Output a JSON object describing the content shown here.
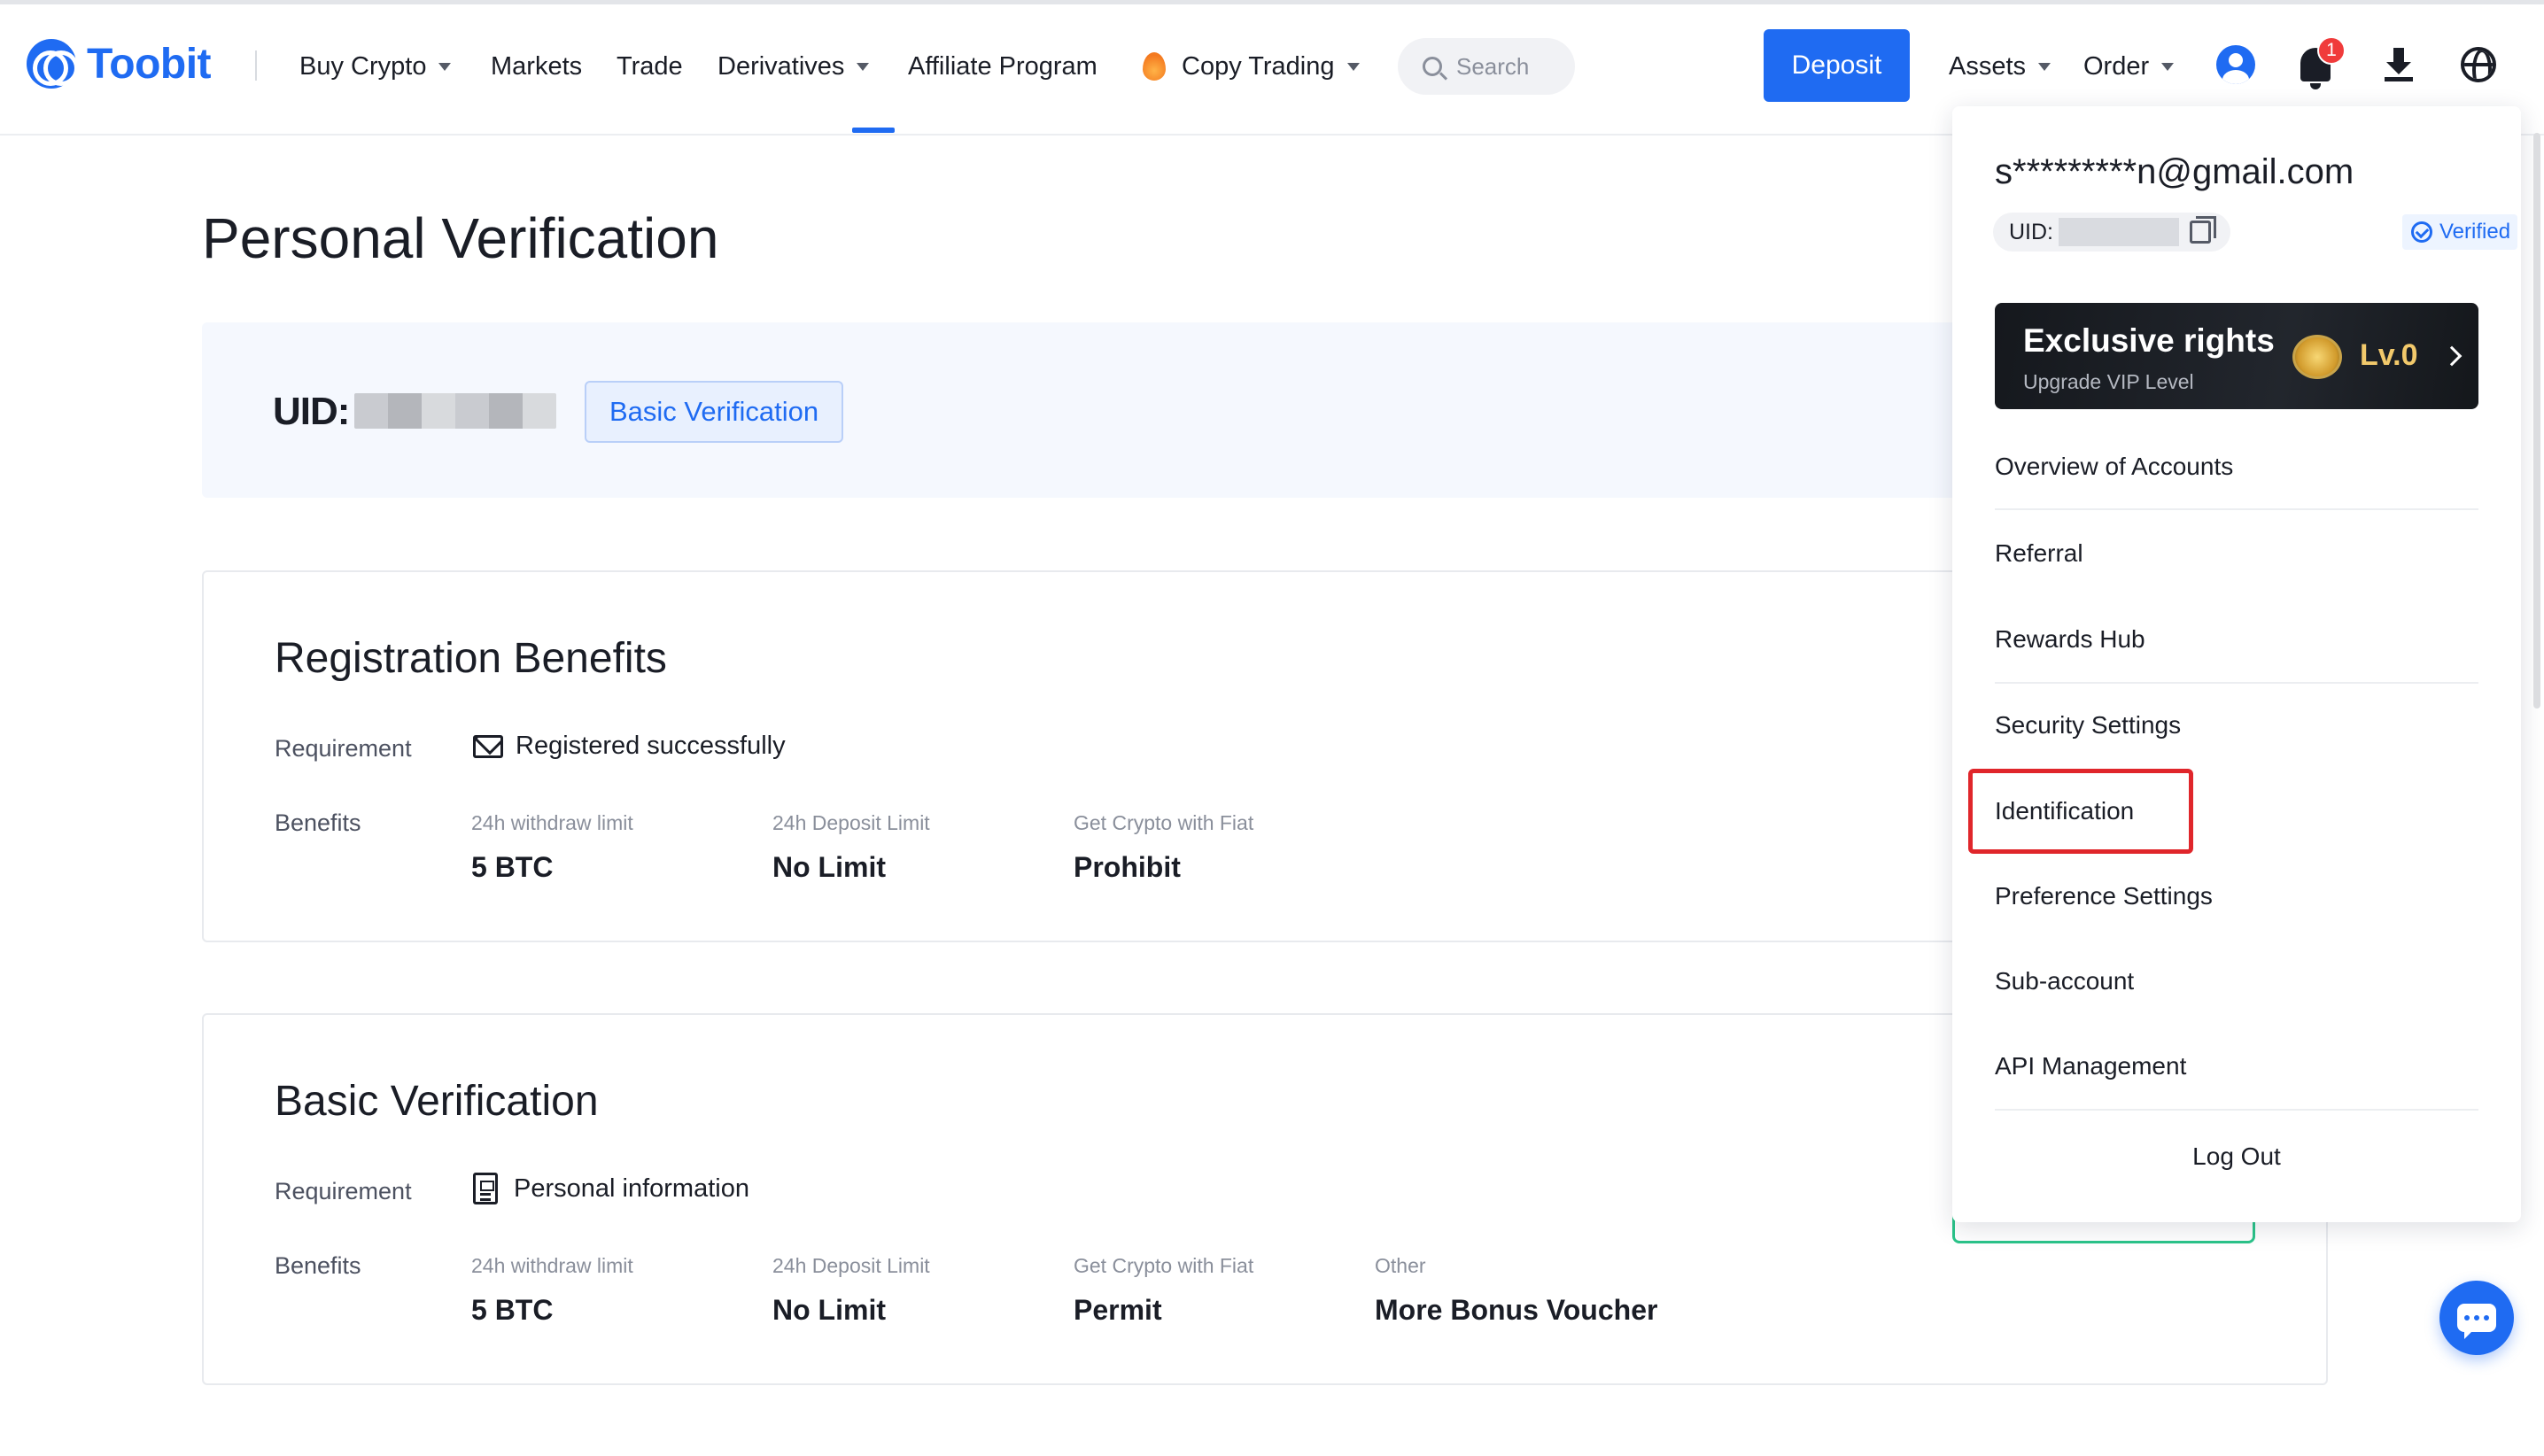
{
  "header": {
    "brand": "Toobit",
    "nav": {
      "buy_crypto": "Buy Crypto",
      "markets": "Markets",
      "trade": "Trade",
      "derivatives": "Derivatives",
      "affiliate": "Affiliate Program",
      "copy_trading": "Copy Trading"
    },
    "search_placeholder": "Search",
    "deposit": "Deposit",
    "assets": "Assets",
    "order": "Order",
    "notification_count": "1",
    "brand_color": "#1f6bf2"
  },
  "main": {
    "title": "Personal Verification",
    "uid_label": "UID:",
    "verification_tag": "Basic Verification",
    "cards": [
      {
        "title": "Registration Benefits",
        "requirement_label": "Requirement",
        "requirement_value": "Registered successfully",
        "requirement_icon": "mail-icon",
        "benefits_label": "Benefits",
        "benefits": [
          {
            "label": "24h withdraw limit",
            "value": "5 BTC"
          },
          {
            "label": "24h Deposit Limit",
            "value": "No Limit"
          },
          {
            "label": "Get Crypto with Fiat",
            "value": "Prohibit"
          }
        ]
      },
      {
        "title": "Basic Verification",
        "requirement_label": "Requirement",
        "requirement_value": "Personal information",
        "requirement_icon": "document-icon",
        "benefits_label": "Benefits",
        "benefits": [
          {
            "label": "24h withdraw limit",
            "value": "5 BTC"
          },
          {
            "label": "24h Deposit Limit",
            "value": "No Limit"
          },
          {
            "label": "Get Crypto with Fiat",
            "value": "Permit"
          },
          {
            "label": "Other",
            "value": "More Bonus Voucher"
          }
        ]
      }
    ]
  },
  "dropdown": {
    "email": "s*********n@gmail.com",
    "uid_label": "UID:",
    "verified": "Verified",
    "vip": {
      "title": "Exclusive rights",
      "subtitle": "Upgrade VIP Level",
      "level": "Lv.0"
    },
    "menu": [
      "Overview of Accounts",
      "Referral",
      "Rewards Hub",
      "Security Settings",
      "Identification",
      "Preference Settings",
      "Sub-account",
      "API Management"
    ],
    "highlighted_item": "Identification",
    "highlight_color": "#e0262b",
    "logout": "Log Out"
  }
}
